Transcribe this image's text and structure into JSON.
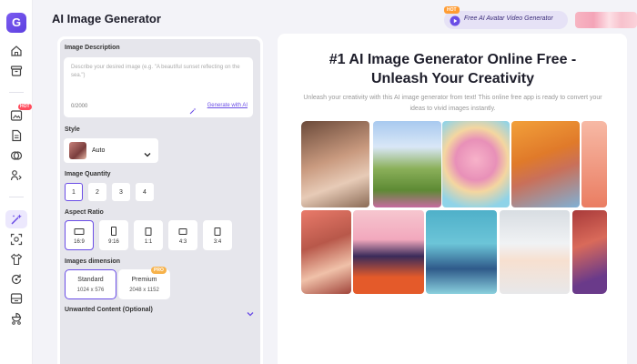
{
  "app": {
    "title": "AI Image Generator",
    "logo_letter": "G"
  },
  "header": {
    "promo_label": "Free AI Avatar Video Generator",
    "promo_badge": "HOT"
  },
  "sidebar": {
    "badge": "HOT",
    "items": [
      {
        "icon": "home-icon"
      },
      {
        "icon": "archive-icon"
      },
      {
        "icon": "image-edit-icon"
      },
      {
        "icon": "document-icon"
      },
      {
        "icon": "layers-icon"
      },
      {
        "icon": "person-swap-icon"
      },
      {
        "icon": "sparkle-wand-icon",
        "active": true
      },
      {
        "icon": "scan-face-icon"
      },
      {
        "icon": "shirt-icon"
      },
      {
        "icon": "refresh-icon"
      },
      {
        "icon": "storage-icon"
      },
      {
        "icon": "stroller-icon"
      }
    ]
  },
  "form": {
    "description": {
      "label": "Image Description",
      "placeholder": "Describe your desired image (e.g. \"A beautiful sunset reflecting on the sea.\")",
      "count": "0/2000",
      "generate_link": "Generate with AI"
    },
    "style": {
      "label": "Style",
      "value": "Auto"
    },
    "quantity": {
      "label": "Image Quantity",
      "options": [
        "1",
        "2",
        "3",
        "4"
      ],
      "selected": "1"
    },
    "aspect": {
      "label": "Aspect Ratio",
      "options": [
        "16:9",
        "9:16",
        "1:1",
        "4:3",
        "3:4"
      ],
      "selected": "16:9"
    },
    "dimension": {
      "label": "Images dimension",
      "options": [
        {
          "name": "Standard",
          "size": "1024 x 576"
        },
        {
          "name": "Premium",
          "size": "2048 x 1152",
          "badge": "PRO"
        }
      ],
      "selected": "Standard"
    },
    "unwanted": {
      "label": "Unwanted Content (Optional)"
    }
  },
  "hero": {
    "headline": "#1 AI Image Generator Online Free - Unleash Your Creativity",
    "subline": "Unleash your creativity with this AI image generator from text! This online free app is ready to convert your ideas to vivid images instantly."
  },
  "colors": {
    "accent": "#6a4de6",
    "hot": "#ff4d5e",
    "pro": "#f7b24a"
  }
}
